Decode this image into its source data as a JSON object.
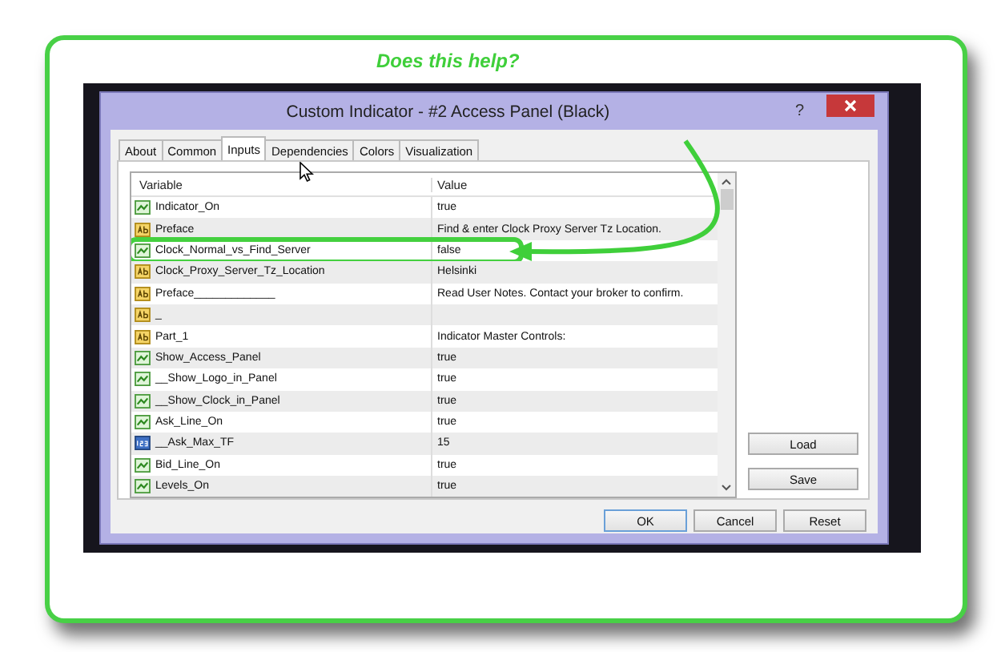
{
  "annotation": {
    "caption": "Does this help?"
  },
  "window": {
    "title": "Custom Indicator - #2 Access Panel (Black)",
    "help": "?"
  },
  "tabs": [
    {
      "label": "About",
      "selected": false
    },
    {
      "label": "Common",
      "selected": false
    },
    {
      "label": "Inputs",
      "selected": true
    },
    {
      "label": "Dependencies",
      "selected": false
    },
    {
      "label": "Colors",
      "selected": false
    },
    {
      "label": "Visualization",
      "selected": false
    }
  ],
  "table": {
    "columns": [
      "Variable",
      "Value"
    ],
    "rows": [
      {
        "kind": "bool",
        "variable": "Indicator_On",
        "value": "true",
        "highlighted": false
      },
      {
        "kind": "string",
        "variable": "Preface",
        "value": "Find & enter Clock Proxy Server Tz Location.",
        "highlighted": false
      },
      {
        "kind": "bool",
        "variable": "Clock_Normal_vs_Find_Server",
        "value": "false",
        "highlighted": true
      },
      {
        "kind": "string",
        "variable": "Clock_Proxy_Server_Tz_Location",
        "value": "Helsinki",
        "highlighted": false
      },
      {
        "kind": "string",
        "variable": "Preface_____________",
        "value": "Read User Notes.  Contact your broker to confirm.",
        "highlighted": false
      },
      {
        "kind": "string",
        "variable": "_",
        "highlighted": false
      },
      {
        "kind": "string",
        "variable": "Part_1",
        "value": "Indicator Master Controls:",
        "highlighted": false
      },
      {
        "kind": "bool",
        "variable": "Show_Access_Panel",
        "value": "true",
        "highlighted": false
      },
      {
        "kind": "bool",
        "variable": "__Show_Logo_in_Panel",
        "value": "true",
        "highlighted": false
      },
      {
        "kind": "bool",
        "variable": "__Show_Clock_in_Panel",
        "value": "true",
        "highlighted": false
      },
      {
        "kind": "bool",
        "variable": "Ask_Line_On",
        "value": "true",
        "highlighted": false
      },
      {
        "kind": "int",
        "variable": "__Ask_Max_TF",
        "value": "15",
        "highlighted": false
      },
      {
        "kind": "bool",
        "variable": "Bid_Line_On",
        "value": "true",
        "highlighted": false
      },
      {
        "kind": "bool",
        "variable": "Levels_On",
        "value": "true",
        "highlighted": false
      }
    ]
  },
  "side_buttons": [
    "Load",
    "Save"
  ],
  "buttons": [
    "OK",
    "Cancel",
    "Reset"
  ]
}
